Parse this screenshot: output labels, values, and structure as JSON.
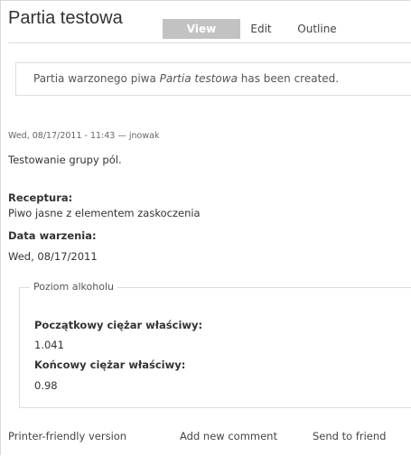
{
  "node": {
    "title": "Partia testowa",
    "tabs": [
      {
        "label": "View",
        "active": true
      },
      {
        "label": "Edit",
        "active": false
      },
      {
        "label": "Outline",
        "active": false
      }
    ],
    "status_message": {
      "prefix": "Partia warzonego piwa ",
      "emphasis": "Partia testowa",
      "suffix": " has been created."
    },
    "submitted": "Wed, 08/17/2011 - 11:43 — jnowak",
    "body": "Testowanie grupy pól.",
    "fields": {
      "recipe_label": "Receptura:",
      "recipe_value": "Piwo jasne z elementem zaskoczenia",
      "brew_date_label": "Data warzenia:",
      "brew_date_value": "Wed, 08/17/2011"
    },
    "alcohol_group": {
      "legend": "Poziom alkoholu",
      "og_label": "Początkowy ciężar właściwy:",
      "og_value": "1.041",
      "fg_label": "Końcowy ciężar właściwy:",
      "fg_value": "0.98"
    },
    "links": [
      {
        "label": "Printer-friendly version"
      },
      {
        "label": "Add new comment"
      },
      {
        "label": "Send to friend"
      }
    ]
  },
  "colors": {
    "active_tab_bg": "#c2c2c2",
    "border": "#dddddd",
    "text": "#333333"
  }
}
